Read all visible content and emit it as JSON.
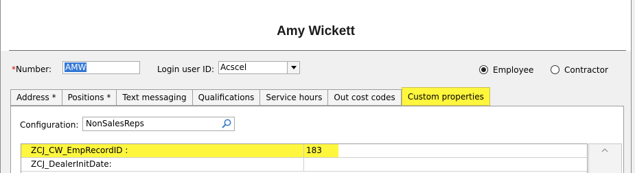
{
  "window": {
    "title": "Amy Wickett"
  },
  "header": {
    "number_required_mark": "*",
    "number_label": "Number:",
    "number_value": "AMW",
    "login_label": "Login user ID:",
    "login_value": "Acscel",
    "employee_label": "Employee",
    "contractor_label": "Contractor",
    "selected_type": "Employee"
  },
  "tabs": [
    {
      "label": "Address *",
      "active": false
    },
    {
      "label": "Positions *",
      "active": false
    },
    {
      "label": "Text messaging",
      "active": false
    },
    {
      "label": "Qualifications",
      "active": false
    },
    {
      "label": "Service hours",
      "active": false
    },
    {
      "label": "Out cost codes",
      "active": false
    },
    {
      "label": "Custom properties",
      "active": true
    }
  ],
  "custom_properties": {
    "configuration_label": "Configuration:",
    "configuration_value": "NonSalesReps",
    "rows": [
      {
        "name": "ZCJ_CW_EmpRecordID :",
        "value": "183",
        "highlighted": true
      },
      {
        "name": "ZCJ_DealerInitDate:",
        "value": "",
        "highlighted": false
      }
    ]
  },
  "colors": {
    "highlight": "#fff63e",
    "selection": "#3478d6",
    "required": "#d40000"
  },
  "icons": {
    "search": "search-icon",
    "dropdown": "chevron-down-icon",
    "scroll": "scroll-up-arrow-icon"
  }
}
